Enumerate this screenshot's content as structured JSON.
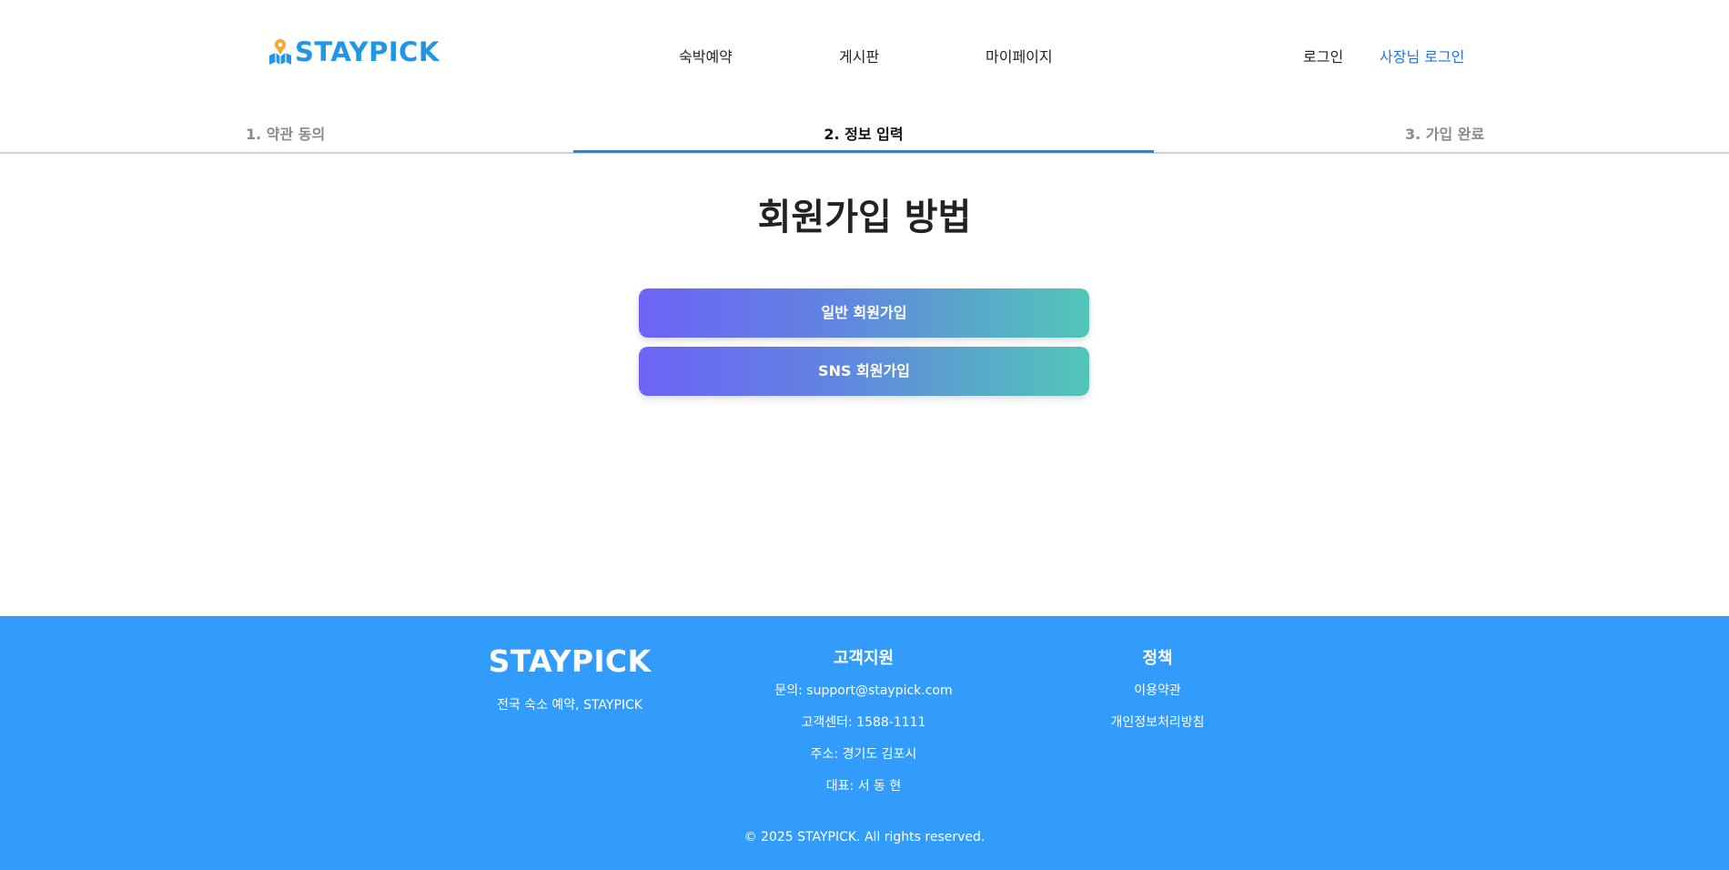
{
  "header": {
    "logo_text": "STAYPICK",
    "nav": [
      "숙박예약",
      "게시판",
      "마이페이지"
    ],
    "login": "로그인",
    "owner_login": "사장님 로그인"
  },
  "steps": [
    {
      "label": "1. 약관 동의",
      "active": false
    },
    {
      "label": "2. 정보 입력",
      "active": true
    },
    {
      "label": "3. 가입 완료",
      "active": false
    }
  ],
  "main": {
    "title": "회원가입 방법",
    "buttons": {
      "general": "일반 회원가입",
      "sns": "SNS 회원가입"
    }
  },
  "footer": {
    "brand": "STAYPICK",
    "tagline": "전국 숙소 예약, STAYPICK",
    "support": {
      "heading": "고객지원",
      "lines": [
        "문의: support@staypick.com",
        "고객센터: 1588-1111",
        "주소: 경기도 김포시",
        "대표: 서 동 현"
      ]
    },
    "policy": {
      "heading": "정책",
      "links": [
        "이용약관",
        "개인정보처리방침"
      ]
    },
    "copyright": "© 2025 STAYPICK. All rights reserved."
  },
  "colors": {
    "brand": "#2196e6",
    "owner_link": "#1f73e6",
    "active_step": "#1e88e5",
    "footer_bg": "#329cfc",
    "button_gradient": [
      "#6c63f6",
      "#52c6b7"
    ]
  },
  "icons": {
    "logo": "map-pin-icon"
  }
}
